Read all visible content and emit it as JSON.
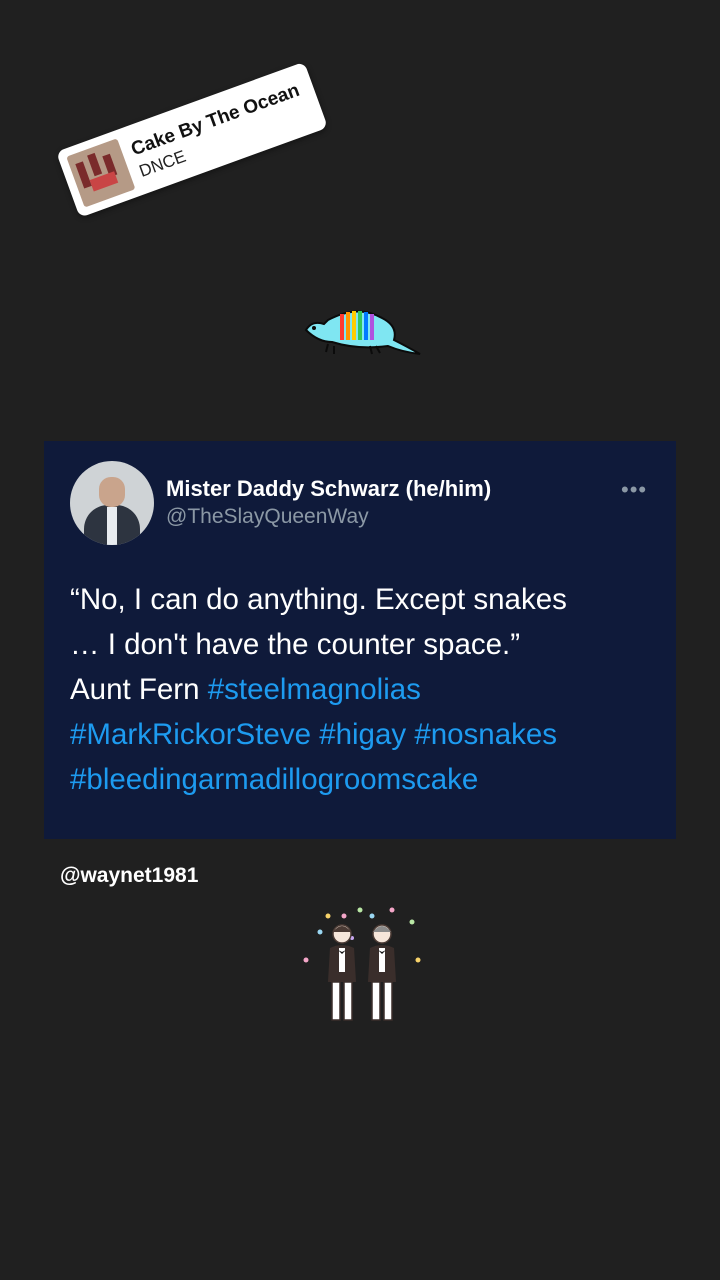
{
  "music": {
    "title": "Cake By The Ocean",
    "artist": "DNCE",
    "album_art_icon": "album-cover"
  },
  "stickers": {
    "armadillo": "rainbow-armadillo-icon",
    "grooms": "two-grooms-icon"
  },
  "tweet": {
    "display_name": "Mister Daddy Schwarz (he/him)",
    "handle": "@TheSlayQueenWay",
    "more_icon": "•••",
    "text_line1": "“No, I can do anything. Except snakes",
    "text_line2": "… I don't have the counter space.”",
    "text_line3": "Aunt Fern",
    "hashtags": {
      "h1": "#steelmagnolias",
      "h2": "#MarkRickorSteve",
      "h3": "#higay",
      "h4": "#nosnakes",
      "h5": "#bleedingarmadillogroomscake"
    },
    "colors": {
      "card_bg": "#0f1a3a",
      "hashtag": "#1d9bf0",
      "muted": "#8b98a5"
    }
  },
  "username_tag": "@waynet1981",
  "colors": {
    "background": "#202020"
  }
}
